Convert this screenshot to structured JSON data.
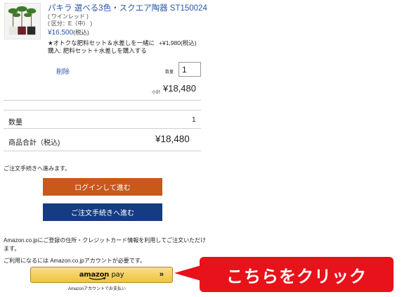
{
  "product": {
    "name": "パキラ 選べる3色・スクエア陶器 ST150024",
    "variant": "( ワインレッド )",
    "size_class": "( 区分：E（中） )",
    "price": "¥16,500",
    "price_tax": "(税込)",
    "image_icon": "potted-plant-photo"
  },
  "option": {
    "text": "★オトクな肥料セット＆水差しを一緒に",
    "price": "+¥1,980(税込)",
    "purchase": "購入: 肥料セット＋水差しを購入する"
  },
  "item_actions": {
    "delete_label": "削除",
    "qty_label": "数量",
    "qty_value": "1",
    "subtotal_label": "小計",
    "subtotal_value": "¥18,480"
  },
  "summary": {
    "qty_label": "数量",
    "qty_value": "1",
    "total_label": "商品合計（税込)",
    "total_value": "¥18,480"
  },
  "checkout": {
    "proceed_text": "ご注文手続きへ進みます。",
    "login_button": "ログインして進む",
    "checkout_button": "ご注文手続きへ進む"
  },
  "amazon": {
    "info_text": "Amazon.co.jpにご登録の住所・クレジットカード情報を利用してご注文いただけます。",
    "account_note": "ご利用になるには Amazon.co.jpアカウントが必要です。",
    "button_brand": "amazon",
    "button_pay": "pay",
    "button_chevron": "»",
    "button_caption": "Amazonアカウントでお支払い",
    "colors": {
      "button_top": "#f9dd8b",
      "button_bottom": "#f1c43c"
    }
  },
  "callout": {
    "text": "こちらをクリック",
    "color": "#e8121a"
  },
  "colors": {
    "link": "#2a56a8",
    "login_button": "#c9581b",
    "checkout_button": "#153c80"
  }
}
